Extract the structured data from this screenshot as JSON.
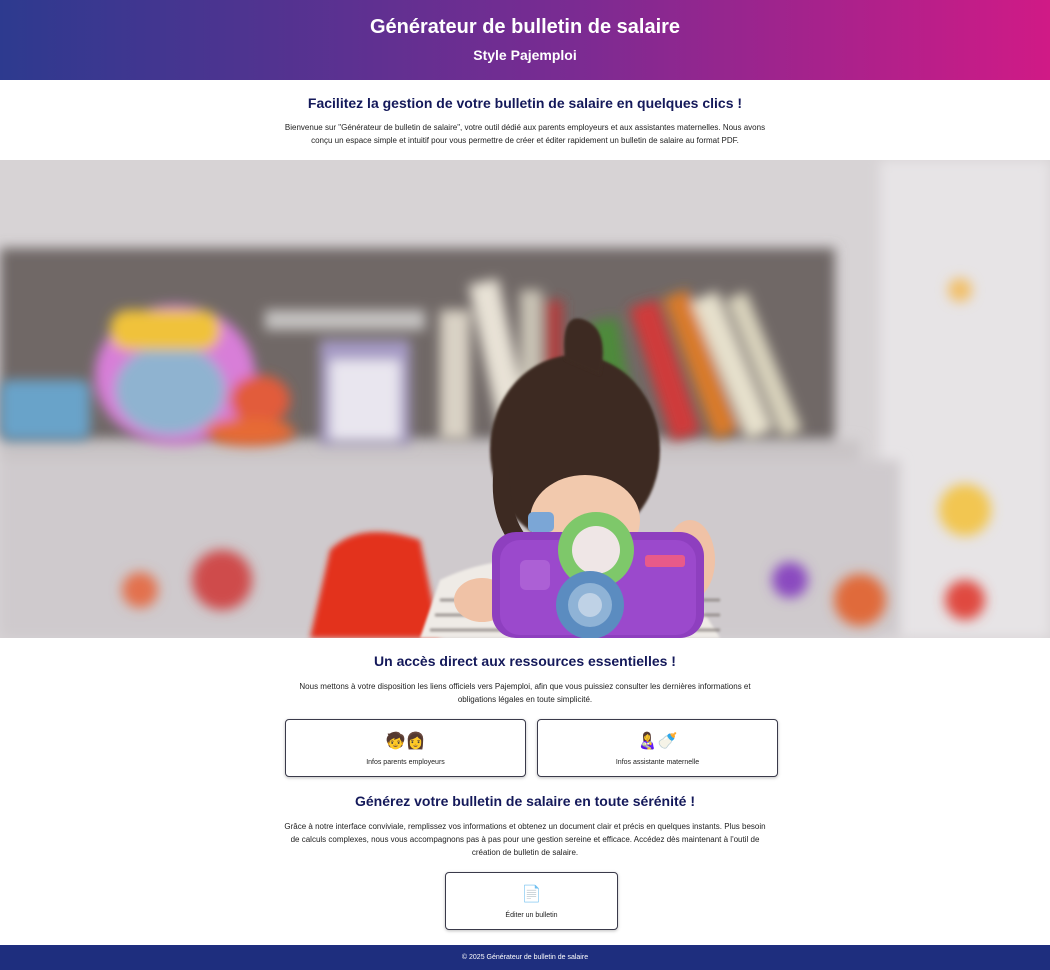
{
  "header": {
    "title": "Générateur de bulletin de salaire",
    "subtitle": "Style Pajemploi"
  },
  "intro": {
    "title": "Facilitez la gestion de votre bulletin de salaire en quelques clics !",
    "text": "Bienvenue sur \"Générateur de bulletin de salaire\", votre outil dédié aux parents employeurs et aux assistantes maternelles. Nous avons conçu un espace simple et intuitif pour vous permettre de créer et éditer rapidement un bulletin de salaire au format PDF."
  },
  "resources": {
    "title": "Un accès direct aux ressources essentielles !",
    "text": "Nous mettons à votre disposition les liens officiels vers Pajemploi, afin que vous puissiez consulter les dernières informations et obligations légales en toute simplicité.",
    "cards": [
      {
        "icon": "🧒👩",
        "label": "Infos parents employeurs"
      },
      {
        "icon": "👩‍🍼🍼",
        "label": "Infos assistante maternelle"
      }
    ]
  },
  "generate": {
    "title": "Générez votre bulletin de salaire en toute sérénité !",
    "text": "Grâce à notre interface conviviale, remplissez vos informations et obtenez un document clair et précis en quelques instants. Plus besoin de calculs complexes, nous vous accompagnons pas à pas pour une gestion sereine et efficace. Accédez dès maintenant à l'outil de création de bulletin de salaire.",
    "button": {
      "icon": "📄",
      "label": "Éditer un bulletin"
    }
  },
  "footer": {
    "text": "© 2025 Générateur de bulletin de salaire"
  },
  "colors": {
    "header_gradient_start": "#2d3a8f",
    "header_gradient_end": "#d01a86",
    "title_color": "#14195a",
    "footer_bg": "#1e2e7e"
  }
}
